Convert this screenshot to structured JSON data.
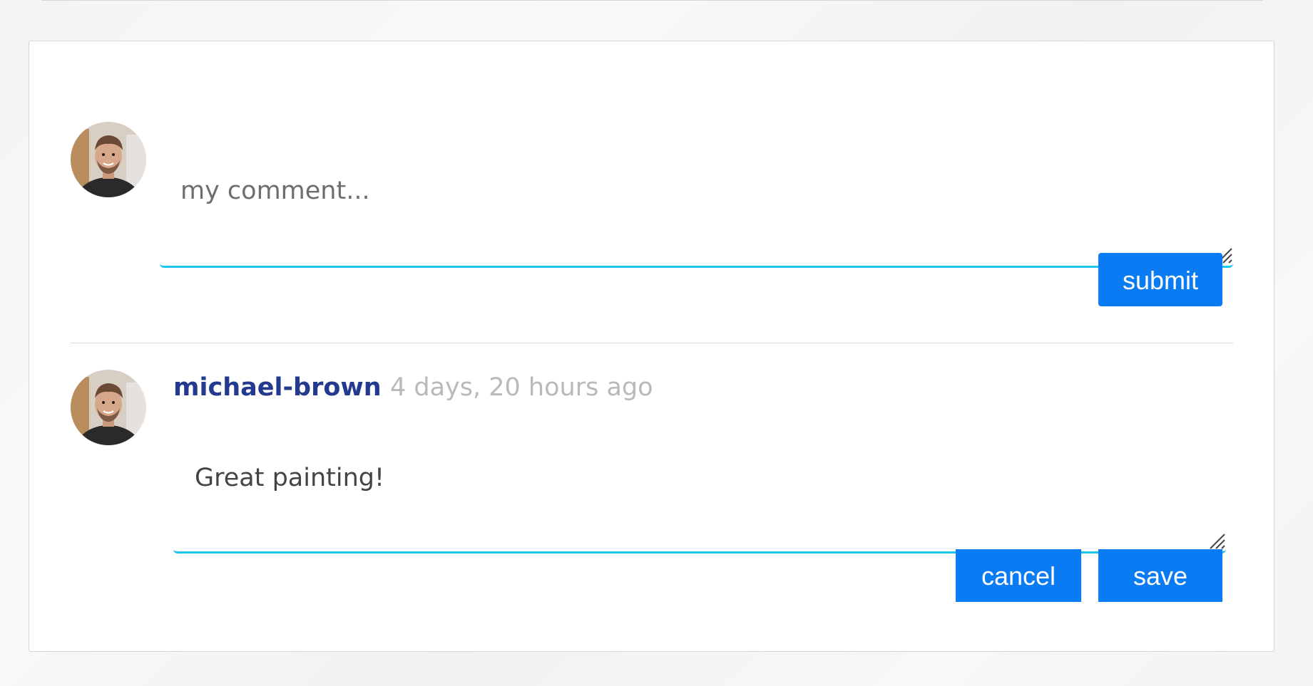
{
  "new_comment": {
    "placeholder": "my comment...",
    "submit_label": "submit"
  },
  "comments": [
    {
      "author": "michael-brown",
      "time_ago": "4 days, 20 hours ago",
      "text": "Great painting!",
      "cancel_label": "cancel",
      "save_label": "save"
    }
  ],
  "icons": {
    "avatar": "user-avatar-photo",
    "resize": "resize-grip-icon"
  },
  "colors": {
    "accent": "#0a7cf3",
    "underline": "#1ac6ee",
    "author": "#243a8e",
    "muted": "#b9b9bc"
  }
}
